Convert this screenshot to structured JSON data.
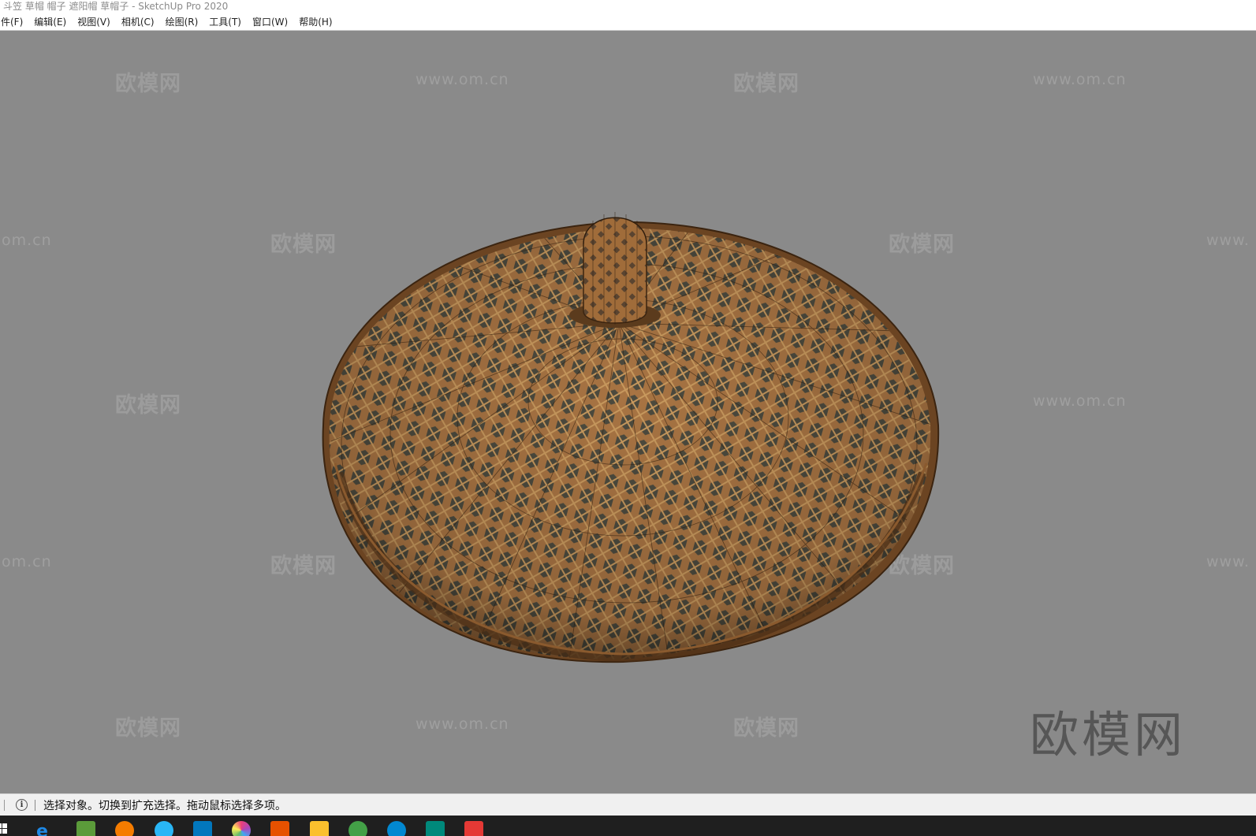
{
  "window": {
    "title": "斗笠 草帽 帽子 遮阳帽 草帽子 - SketchUp Pro 2020"
  },
  "menu": {
    "items": [
      {
        "id": "file",
        "label": "件(F)"
      },
      {
        "id": "edit",
        "label": "编辑(E)"
      },
      {
        "id": "view",
        "label": "视图(V)"
      },
      {
        "id": "camera",
        "label": "相机(C)"
      },
      {
        "id": "draw",
        "label": "绘图(R)"
      },
      {
        "id": "tools",
        "label": "工具(T)"
      },
      {
        "id": "window",
        "label": "窗口(W)"
      },
      {
        "id": "help",
        "label": "帮助(H)"
      }
    ]
  },
  "watermark": {
    "brand": "欧模网",
    "url": "www.om.cn",
    "url_partial_left": "om.cn",
    "url_partial_right": "www."
  },
  "status": {
    "message": "选择对象。切换到扩充选择。拖动鼠标选择多项。"
  },
  "colors": {
    "viewport_bg": "#8a8a8a",
    "hat_dark": "#5a3a1e",
    "hat_light": "#b07a45",
    "taskbar_bg": "#1f1f1f"
  },
  "taskbar": {
    "icons": [
      {
        "name": "windows-start-icon",
        "color": "#ffffff"
      },
      {
        "name": "internet-explorer-icon",
        "color": "#1e88e5"
      },
      {
        "name": "minecraft-icon",
        "color": "#5b9b3a"
      },
      {
        "name": "media-player-icon",
        "color": "#f57c00"
      },
      {
        "name": "qq-browser-icon",
        "color": "#29b6f6"
      },
      {
        "name": "app-store-icon",
        "color": "#0277bd"
      },
      {
        "name": "color-wheel-icon",
        "color": "#ec407a"
      },
      {
        "name": "tool-app-icon",
        "color": "#e65100"
      },
      {
        "name": "file-explorer-icon",
        "color": "#fbc02d"
      },
      {
        "name": "wechat-icon",
        "color": "#43a047"
      },
      {
        "name": "edge-icon",
        "color": "#0288d1"
      },
      {
        "name": "3ds-max-icon",
        "color": "#00897b"
      },
      {
        "name": "sketchup-icon",
        "color": "#e53935"
      }
    ]
  }
}
